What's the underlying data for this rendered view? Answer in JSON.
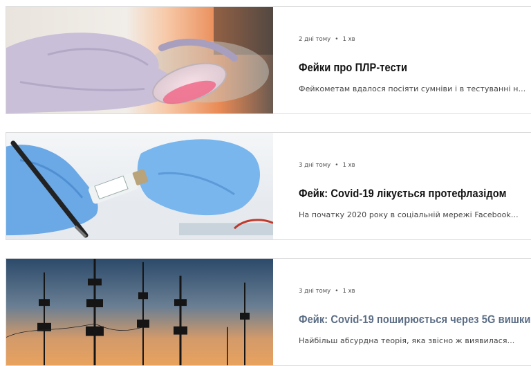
{
  "posts": [
    {
      "image_alt": "gloved-hand-petri-dish",
      "meta": {
        "date": "2 дні тому",
        "read_time": "1 хв"
      },
      "title": "Фейки про ПЛР-тести",
      "excerpt": "Фейкометам вдалося посіяти сумніви і в тестуванні н..."
    },
    {
      "image_alt": "gloved-hands-vaccine-vial",
      "meta": {
        "date": "3 дні тому",
        "read_time": "1 хв"
      },
      "title": "Фейк: Covid-19 лікується протефлазідом",
      "excerpt": "На початку 2020 року в соціальній мережі Facebook..."
    },
    {
      "image_alt": "telecom-towers-sunset",
      "meta": {
        "date": "3 дні тому",
        "read_time": "1 хв"
      },
      "title": "Фейк: Covid-19 поширюється через 5G вишки",
      "excerpt": "Найбільш абсурдна теорія, яка звісно ж виявилася..."
    }
  ],
  "colors": {
    "title": "#111111",
    "title_hover": "#5b6d85",
    "border": "#dcdcdc"
  }
}
